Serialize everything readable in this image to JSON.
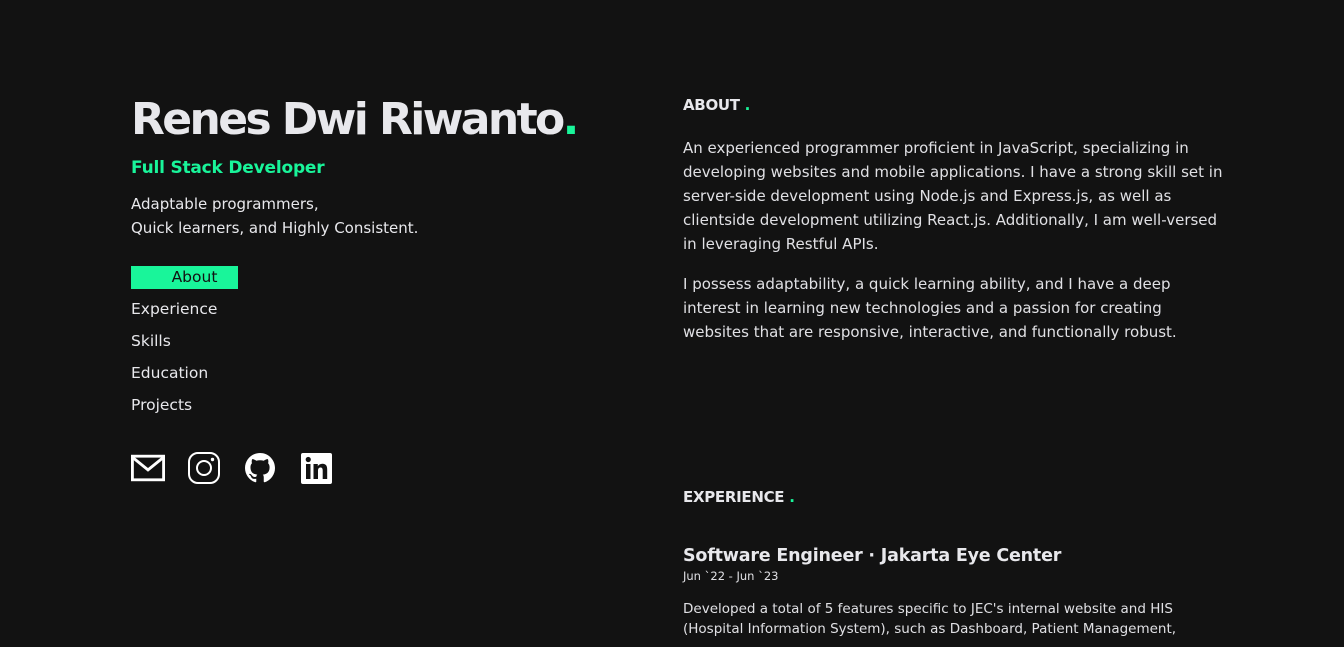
{
  "profile": {
    "name": "Renes Dwi Riwanto",
    "name_dot": ".",
    "role": "Full Stack Developer",
    "tagline_line1": "Adaptable programmers,",
    "tagline_line2": "Quick learners, and Highly Consistent."
  },
  "nav": {
    "items": [
      {
        "label": "About",
        "active": true
      },
      {
        "label": "Experience",
        "active": false
      },
      {
        "label": "Skills",
        "active": false
      },
      {
        "label": "Education",
        "active": false
      },
      {
        "label": "Projects",
        "active": false
      }
    ]
  },
  "socials": [
    {
      "icon": "mail-icon"
    },
    {
      "icon": "instagram-icon"
    },
    {
      "icon": "github-icon"
    },
    {
      "icon": "linkedin-icon"
    }
  ],
  "about": {
    "title": "ABOUT",
    "dot": ".",
    "paragraph1": "An experienced programmer proficient in JavaScript, specializing in developing websites and mobile applications. I have a strong skill set in server-side development using Node.js and Express.js, as well as clientside development utilizing React.js. Additionally, I am well-versed in leveraging Restful APIs.",
    "paragraph2": "I possess adaptability, a quick learning ability, and I have a deep interest in learning new technologies and a passion for creating websites that are responsive, interactive, and functionally robust."
  },
  "experience": {
    "title": "EXPERIENCE",
    "dot": ".",
    "jobs": [
      {
        "title": "Software Engineer · Jakarta Eye Center",
        "date": "Jun `22 - Jun `23",
        "description": "Developed a total of 5 features specific to JEC's internal website and HIS (Hospital Information System), such as Dashboard, Patient Management,"
      }
    ]
  },
  "colors": {
    "background": "#121212",
    "accent": "#19f59a",
    "text": "#e8e8ec"
  }
}
